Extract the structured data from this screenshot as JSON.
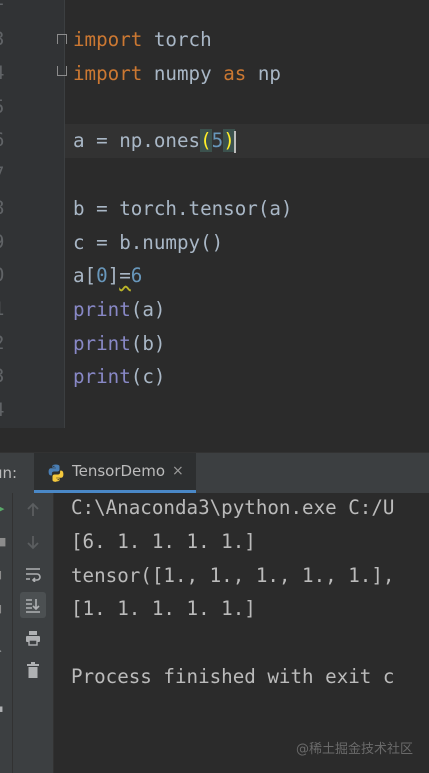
{
  "editor": {
    "line_numbers": [
      "2",
      "3",
      "4",
      "5",
      "6",
      "7",
      "8",
      "9",
      "0",
      "1",
      "2",
      "3",
      "4"
    ],
    "lines": {
      "l3": {
        "kw": "import",
        "rest": " torch"
      },
      "l4": {
        "kw1": "import",
        "mid": " numpy ",
        "kw2": "as",
        "rest": " np"
      },
      "l6": {
        "pre": "a = np.ones",
        "open": "(",
        "num": "5",
        "close": ")"
      },
      "l8": "b = torch.tensor(a)",
      "l9": "c = b.numpy()",
      "l10": {
        "pre": "a[",
        "num": "0",
        "mid": "]",
        "eq": "=",
        "val": "6"
      },
      "l11": {
        "fn": "print",
        "args": "(a)"
      },
      "l12": {
        "fn": "print",
        "args": "(b)"
      },
      "l13": {
        "fn": "print",
        "args": "(c)"
      }
    }
  },
  "run_panel": {
    "label": "un:",
    "tab_label": "TensorDemo",
    "tab_close": "×",
    "output": [
      "C:\\Anaconda3\\python.exe C:/U",
      "[6. 1. 1. 1. 1.]",
      "tensor([1., 1., 1., 1., 1.],",
      "[1. 1. 1. 1. 1.]",
      "",
      "Process finished with exit c"
    ]
  },
  "icons": {
    "tab": "python-icon",
    "tools": [
      "arrow-up-icon",
      "arrow-down-icon",
      "soft-wrap-icon",
      "scroll-to-end-icon",
      "print-icon",
      "trash-icon"
    ]
  },
  "colors": {
    "keyword": "#cc7832",
    "builtin": "#8888c6",
    "number": "#6897bb",
    "text": "#a9b7c6",
    "tab_accent": "#4a88c7"
  },
  "watermark": "@稀土掘金技术社区"
}
